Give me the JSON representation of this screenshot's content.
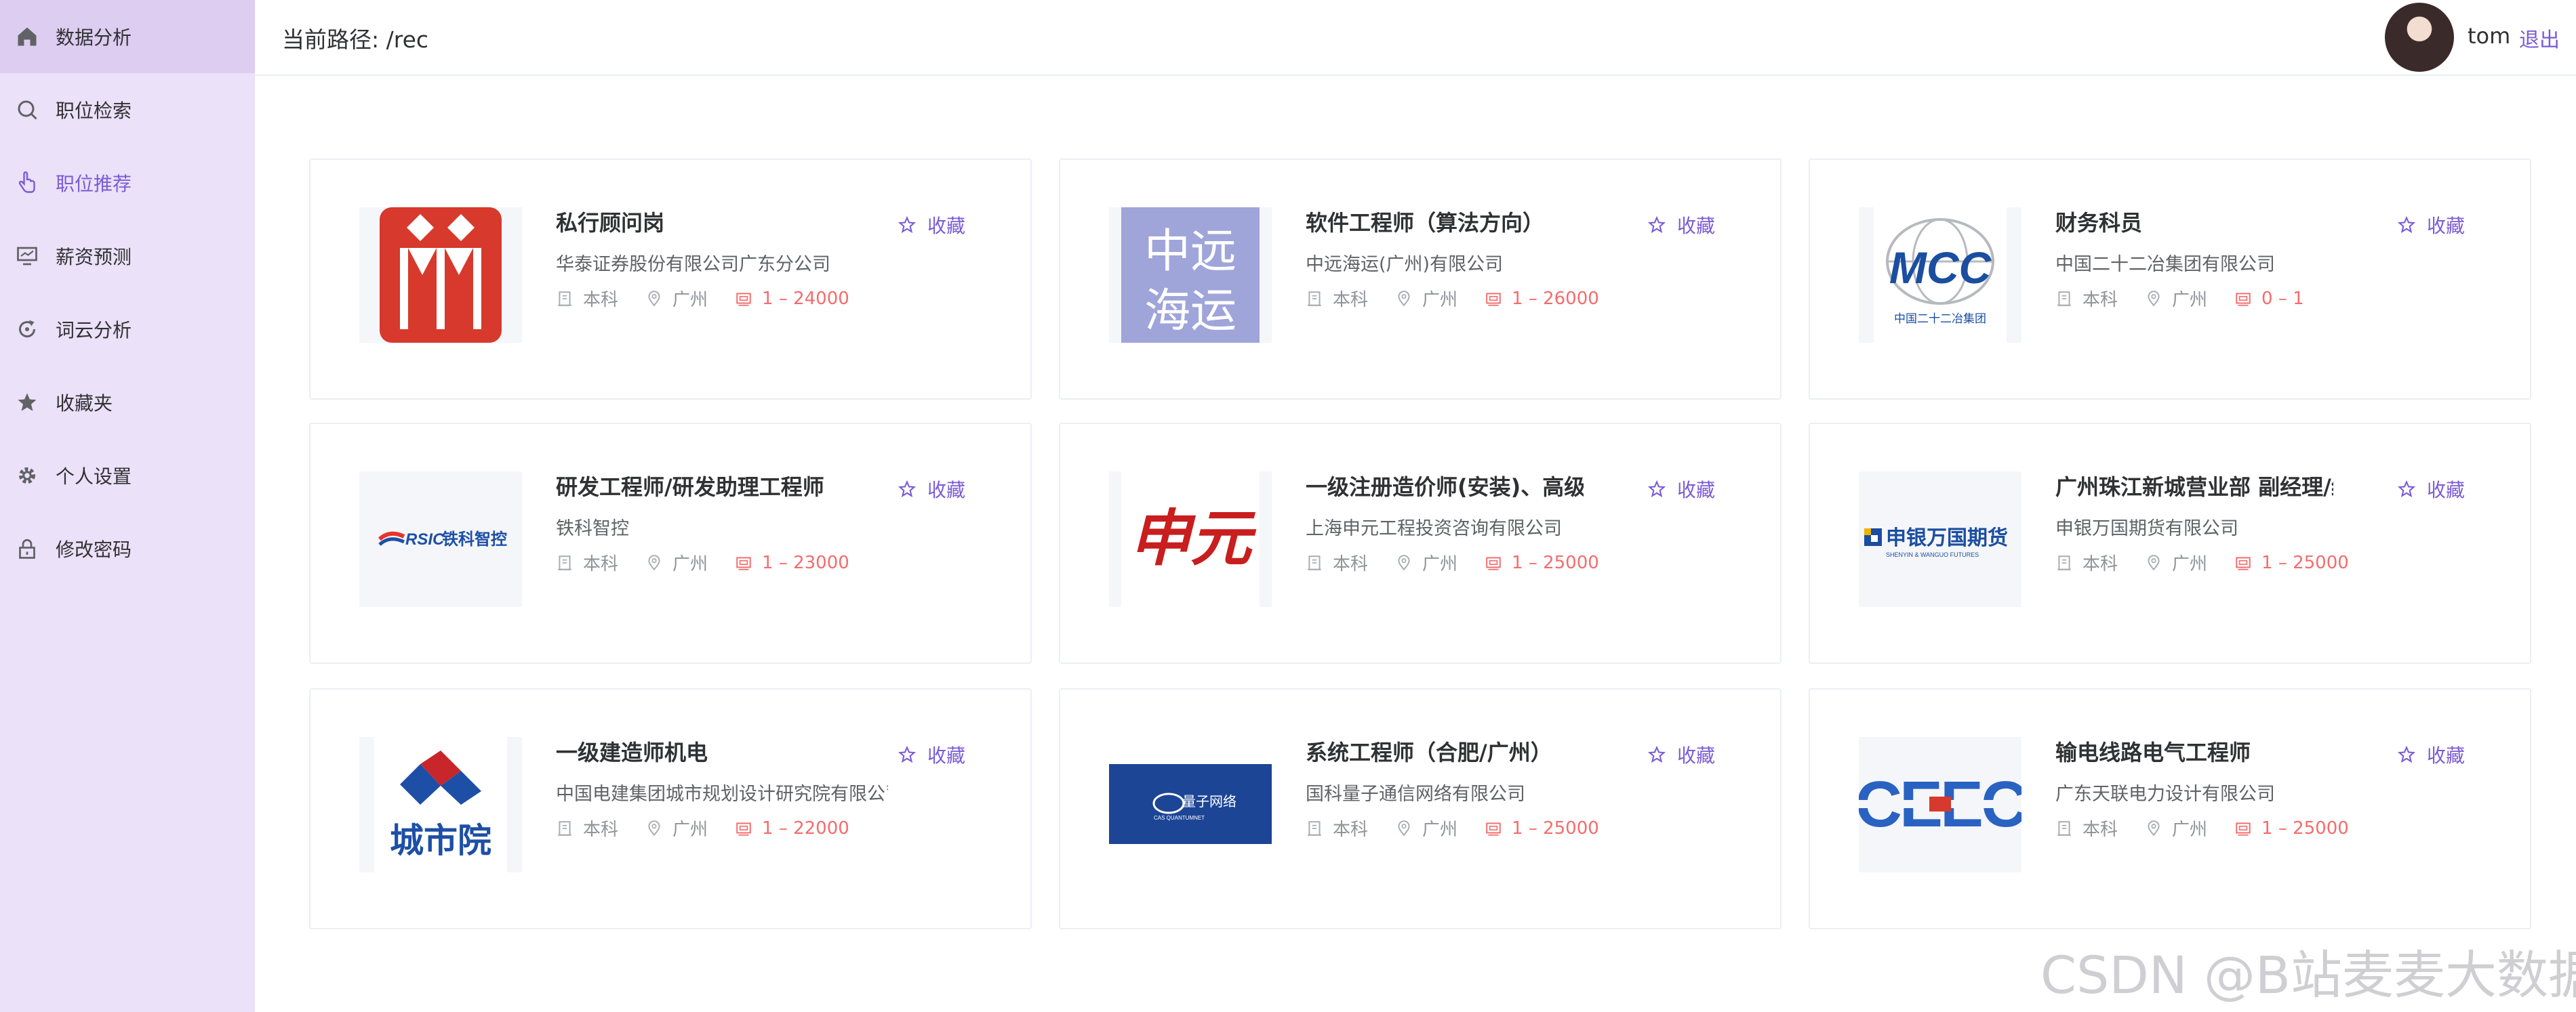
{
  "sidebar": {
    "items": [
      {
        "label": "数据分析",
        "icon": "home-icon"
      },
      {
        "label": "职位检索",
        "icon": "search-icon"
      },
      {
        "label": "职位推荐",
        "icon": "pointer-hand-icon",
        "active": true
      },
      {
        "label": "薪资预测",
        "icon": "monitor-icon"
      },
      {
        "label": "词云分析",
        "icon": "refresh-icon"
      },
      {
        "label": "收藏夹",
        "icon": "star-icon"
      },
      {
        "label": "个人设置",
        "icon": "gear-icon"
      },
      {
        "label": "修改密码",
        "icon": "lock-icon"
      }
    ]
  },
  "header": {
    "path": "当前路径: /rec",
    "username": "tom",
    "logout": "退出"
  },
  "fav_label": "收藏",
  "jobs": [
    {
      "title": "私行顾问岗",
      "company": "华泰证券股份有限公司广东分公司",
      "education": "本科",
      "city": "广州",
      "salary": "1 – 24000",
      "logo": "huatai"
    },
    {
      "title": "软件工程师（算法方向）",
      "company": "中远海运(广州)有限公司",
      "education": "本科",
      "city": "广州",
      "salary": "1 – 26000",
      "logo": "cosco",
      "logo_text": [
        "中远",
        "海运"
      ]
    },
    {
      "title": "财务科员",
      "company": "中国二十二冶集团有限公司",
      "education": "本科",
      "city": "广州",
      "salary": "0 – 1",
      "logo": "mcc",
      "logo_text": [
        "MCC",
        "中国二十二冶集团"
      ]
    },
    {
      "title": "研发工程师/研发助理工程师",
      "company": "铁科智控",
      "education": "本科",
      "city": "广州",
      "salary": "1 – 23000",
      "logo": "rsic",
      "logo_text": [
        "RSIC",
        "铁科智控"
      ]
    },
    {
      "title": "一级注册造价师(安装)、高级工程师",
      "company": "上海申元工程投资咨询有限公司",
      "education": "本科",
      "city": "广州",
      "salary": "1 – 25000",
      "logo": "shenyuan",
      "logo_text": [
        "申元"
      ]
    },
    {
      "title": "广州珠江新城营业部 副经理/经理助理",
      "company": "申银万国期货有限公司",
      "education": "本科",
      "city": "广州",
      "salary": "1 – 25000",
      "logo": "swhy",
      "logo_text": [
        "申银万国期货",
        "SHENYIN & WANGUO FUTURES"
      ]
    },
    {
      "title": "一级建造师机电",
      "company": "中国电建集团城市规划设计研究院有限公司",
      "education": "本科",
      "city": "广州",
      "salary": "1 – 22000",
      "logo": "city",
      "logo_text": [
        "城市院"
      ]
    },
    {
      "title": "系统工程师（合肥/广州）",
      "company": "国科量子通信网络有限公司",
      "education": "本科",
      "city": "广州",
      "salary": "1 – 25000",
      "logo": "quantum",
      "logo_text": [
        "量子网络",
        "CAS QUANTUMNET"
      ]
    },
    {
      "title": "输电线路电气工程师",
      "company": "广东天联电力设计有限公司",
      "education": "本科",
      "city": "广州",
      "salary": "1 – 25000",
      "logo": "ceec",
      "logo_text": [
        "CEEC"
      ]
    }
  ],
  "watermark": "CSDN @B站麦麦大数据",
  "colors": {
    "accent": "#7b5bd6",
    "salary": "#f56c6c",
    "sidebar_bg": "#ebe1f8"
  }
}
